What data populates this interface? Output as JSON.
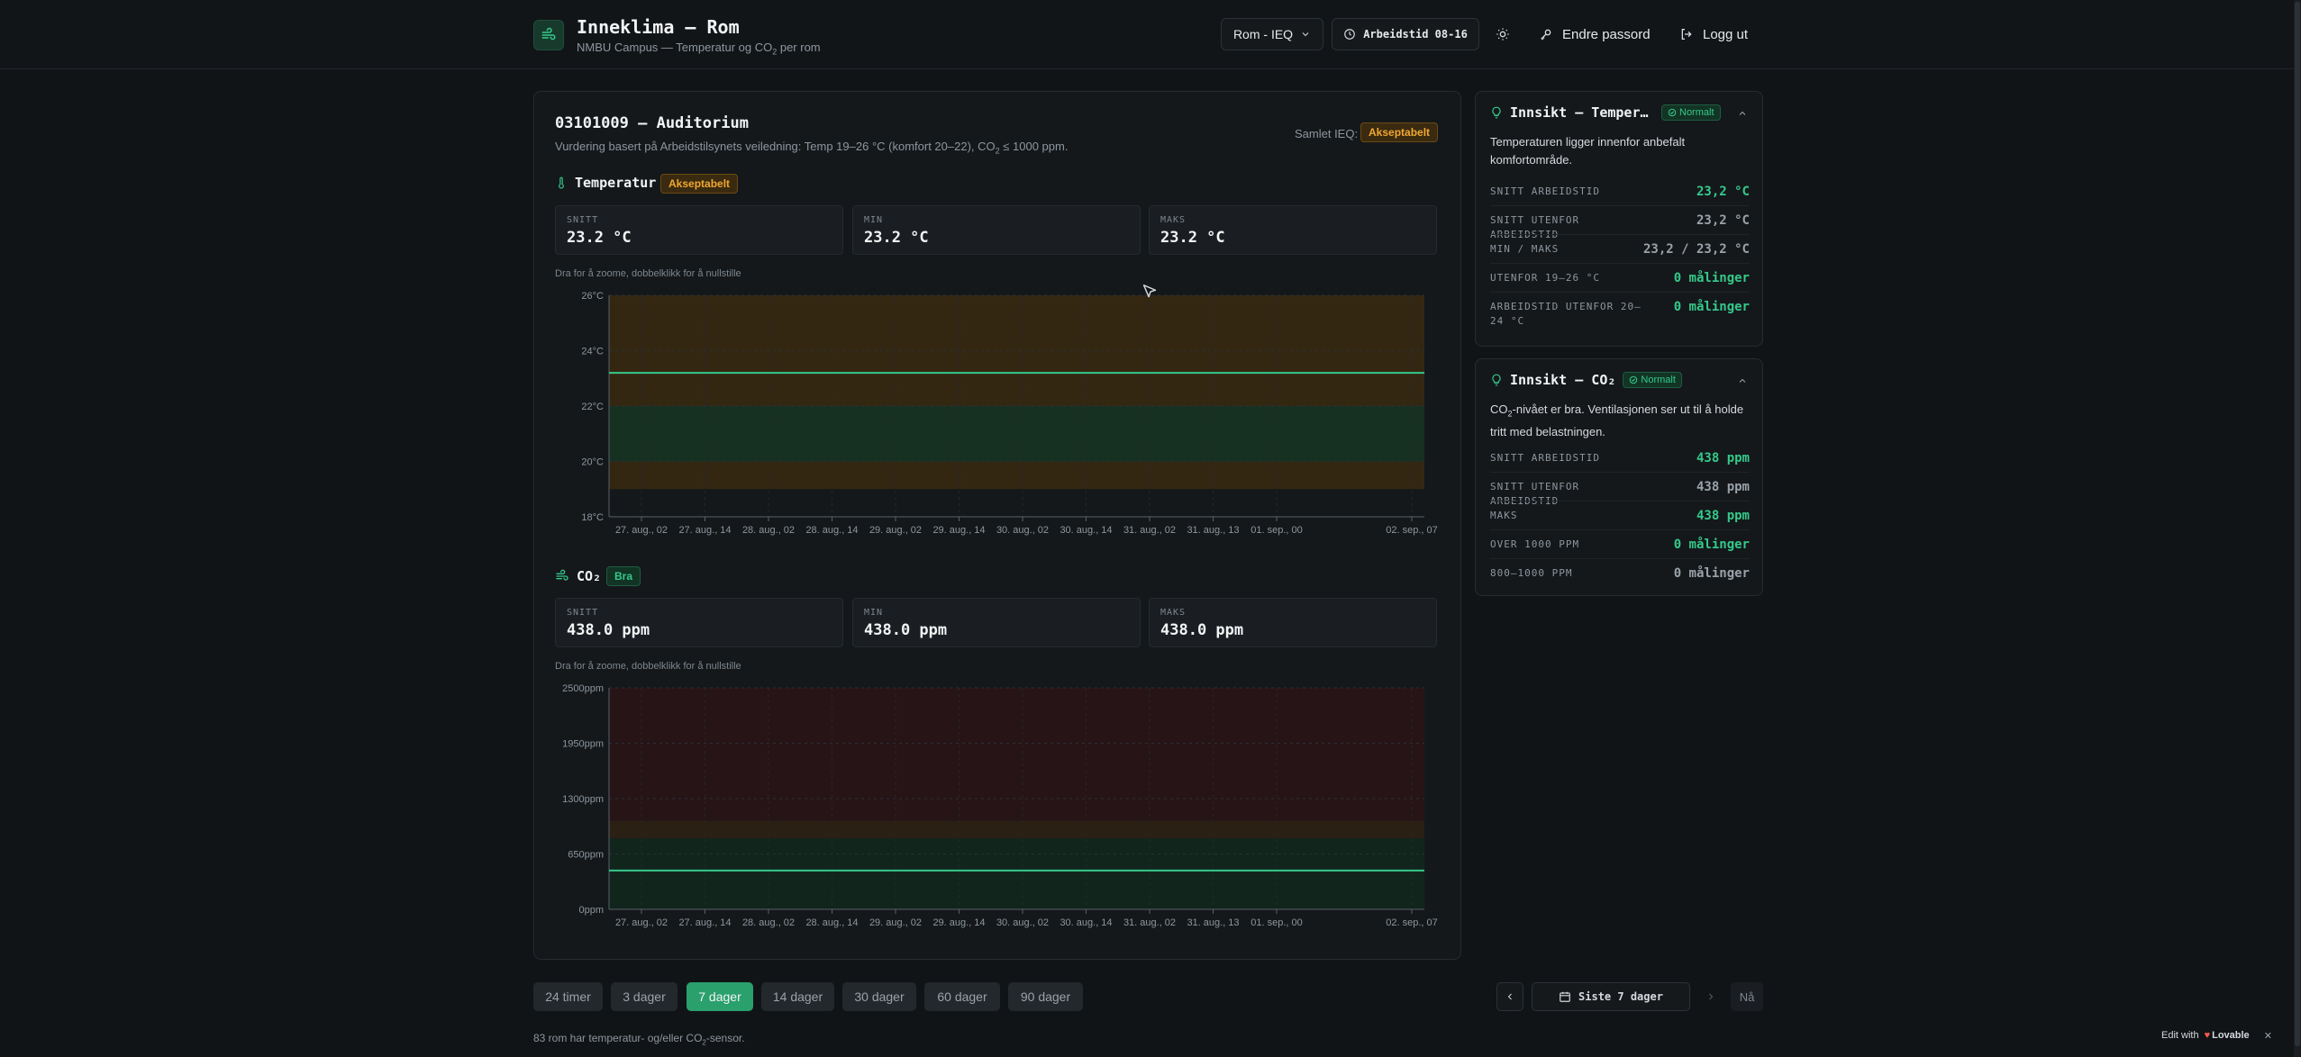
{
  "header": {
    "title": "Inneklima — Rom",
    "subtitle_pre": "NMBU Campus — Temperatur og CO",
    "subtitle_sub": "2",
    "subtitle_post": " per rom",
    "room_select": "Rom - IEQ",
    "work_hours": "Arbeidstid 08-16",
    "change_password": "Endre passord",
    "logout": "Logg ut"
  },
  "room": {
    "title": "03101009 — Auditorium",
    "subtitle_pre": "Vurdering basert på Arbeidstilsynets veiledning: Temp 19–26 °C (komfort 20–22), CO",
    "subtitle_sub": "2",
    "subtitle_post": " ≤ 1000 ppm.",
    "overall_label": "Samlet IEQ:",
    "overall_badge": "Akseptabelt"
  },
  "temperature": {
    "title": "Temperatur",
    "badge": "Akseptabelt",
    "stats": [
      {
        "label": "SNITT",
        "value": "23.2 °C"
      },
      {
        "label": "MIN",
        "value": "23.2 °C"
      },
      {
        "label": "MAKS",
        "value": "23.2 °C"
      }
    ],
    "hint": "Dra for å zoome, dobbelklikk for å nullstille"
  },
  "co2": {
    "title": "CO₂",
    "badge": "Bra",
    "stats": [
      {
        "label": "SNITT",
        "value": "438.0 ppm"
      },
      {
        "label": "MIN",
        "value": "438.0 ppm"
      },
      {
        "label": "MAKS",
        "value": "438.0 ppm"
      }
    ],
    "hint": "Dra for å zoome, dobbelklikk for å nullstille"
  },
  "chart_data": [
    {
      "type": "line",
      "title": "Temperatur",
      "y_ticks": [
        "26°C",
        "24°C",
        "22°C",
        "20°C",
        "18°C"
      ],
      "ylim": [
        18,
        26
      ],
      "x_ticks": [
        "27. aug., 02",
        "27. aug., 14",
        "28. aug., 02",
        "28. aug., 14",
        "29. aug., 02",
        "29. aug., 14",
        "30. aug., 02",
        "30. aug., 14",
        "31. aug., 02",
        "31. aug., 13",
        "01. sep., 00",
        "02. sep., 07"
      ],
      "series": [
        {
          "values": [
            23.2,
            23.2
          ]
        }
      ],
      "bands": [
        {
          "from": 19,
          "to": 26,
          "color": "#3a2a10"
        },
        {
          "from": 20,
          "to": 22,
          "color": "#123425"
        }
      ],
      "grid": true
    },
    {
      "type": "line",
      "title": "CO₂",
      "y_ticks": [
        "2500ppm",
        "1950ppm",
        "1300ppm",
        "650ppm",
        "0ppm"
      ],
      "ylim": [
        0,
        2500
      ],
      "x_ticks": [
        "27. aug., 02",
        "27. aug., 14",
        "28. aug., 02",
        "28. aug., 14",
        "29. aug., 02",
        "29. aug., 14",
        "30. aug., 02",
        "30. aug., 14",
        "31. aug., 02",
        "31. aug., 13",
        "01. sep., 00",
        "02. sep., 07"
      ],
      "series": [
        {
          "values": [
            438,
            438
          ]
        }
      ],
      "bands": [
        {
          "from": 1000,
          "to": 2500,
          "color": "#2a1416"
        },
        {
          "from": 800,
          "to": 1000,
          "color": "#2e2212"
        },
        {
          "from": 0,
          "to": 800,
          "color": "#10281d"
        }
      ],
      "grid": true
    }
  ],
  "insight_temp": {
    "title": "Innsikt — Tempera…",
    "badge": "Normalt",
    "desc": "Temperaturen ligger innenfor anbefalt komfortområde.",
    "rows": [
      {
        "label": "SNITT ARBEIDSTID",
        "value": "23,2 °C",
        "tone": "green"
      },
      {
        "label": "SNITT UTENFOR ARBEIDSTID",
        "value": "23,2 °C",
        "tone": "grey"
      },
      {
        "label": "MIN / MAKS",
        "value": "23,2 / 23,2 °C",
        "tone": "grey"
      },
      {
        "label": "UTENFOR 19–26 °C",
        "value": "0 målinger",
        "tone": "green"
      },
      {
        "label": "ARBEIDSTID UTENFOR 20–24 °C",
        "value": "0 målinger",
        "tone": "green"
      }
    ]
  },
  "insight_co2": {
    "title": "Innsikt — CO₂",
    "badge": "Normalt",
    "desc_pre": "CO",
    "desc_sub": "2",
    "desc_post": "-nivået er bra. Ventilasjonen ser ut til å holde tritt med belastningen.",
    "rows": [
      {
        "label": "SNITT ARBEIDSTID",
        "value": "438 ppm",
        "tone": "green"
      },
      {
        "label": "SNITT UTENFOR ARBEIDSTID",
        "value": "438 ppm",
        "tone": "grey"
      },
      {
        "label": "MAKS",
        "value": "438 ppm",
        "tone": "green"
      },
      {
        "label": "OVER 1000 PPM",
        "value": "0 målinger",
        "tone": "green"
      },
      {
        "label": "800–1000 PPM",
        "value": "0 målinger",
        "tone": "grey"
      }
    ]
  },
  "ranges": [
    "24 timer",
    "3 dager",
    "7 dager",
    "14 dager",
    "30 dager",
    "60 dager",
    "90 dager"
  ],
  "active_range": "7 dager",
  "period_label": "Siste 7 dager",
  "now_label": "Nå",
  "footer_pre": "83 rom har temperatur- og/eller CO",
  "footer_sub": "2",
  "footer_post": "-sensor.",
  "lovable": {
    "edit": "Edit with",
    "brand": "Lovable"
  },
  "colors": {
    "accent": "#35c98a",
    "amber": "#f0a830",
    "bg": "#111417"
  }
}
